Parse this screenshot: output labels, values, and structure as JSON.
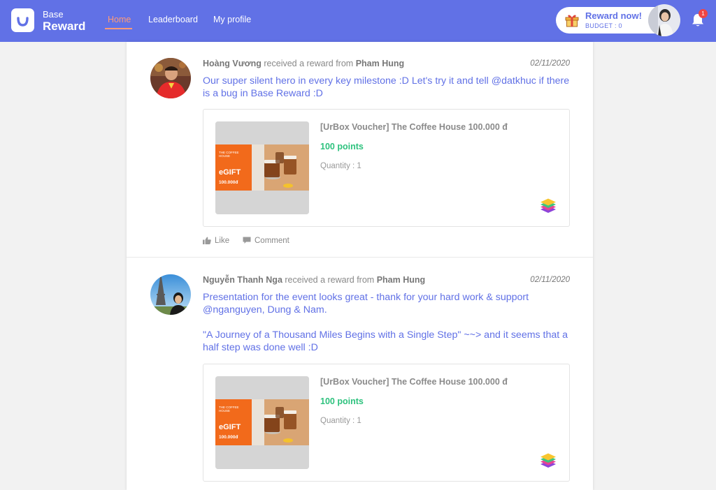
{
  "brand": {
    "top": "Base",
    "main": "Reward"
  },
  "nav": {
    "home": "Home",
    "leaderboard": "Leaderboard",
    "profile": "My profile"
  },
  "header": {
    "reward_button": "Reward now!",
    "budget": "BUDGET : 0",
    "notification_count": "1"
  },
  "colors": {
    "primary": "#6171e6",
    "accent": "#ff9a78",
    "points": "#2ec27e",
    "badge": "#f04545"
  },
  "posts": [
    {
      "recipient": "Hoàng Vương",
      "connector": " received a reward from ",
      "sender": "Pham Hung",
      "date": "02/11/2020",
      "message": [
        "Our super silent hero in every key milestone :D Let's try it and tell @datkhuc if there is a bug in Base Reward :D"
      ],
      "reward": {
        "name": "[UrBox Voucher] The Coffee House 100.000 đ",
        "points": "100 points",
        "quantity": "Quantity : 1",
        "voucher_brand": "THE COFFEE HOUSE",
        "voucher_type": "eGIFT",
        "voucher_value": "100.000đ"
      },
      "actions": {
        "like": "Like",
        "comment": "Comment"
      }
    },
    {
      "recipient": "Nguyễn Thanh Nga",
      "connector": " received a reward from ",
      "sender": "Pham Hung",
      "date": "02/11/2020",
      "message": [
        "Presentation for the event looks great - thank for your hard work & support @nganguyen, Dung & Nam.",
        "\"A Journey of a Thousand Miles Begins with a Single Step\" ~~> and it seems that a half step was done well :D"
      ],
      "reward": {
        "name": "[UrBox Voucher] The Coffee House 100.000 đ",
        "points": "100 points",
        "quantity": "Quantity : 1",
        "voucher_brand": "THE COFFEE HOUSE",
        "voucher_type": "eGIFT",
        "voucher_value": "100.000đ"
      }
    }
  ]
}
